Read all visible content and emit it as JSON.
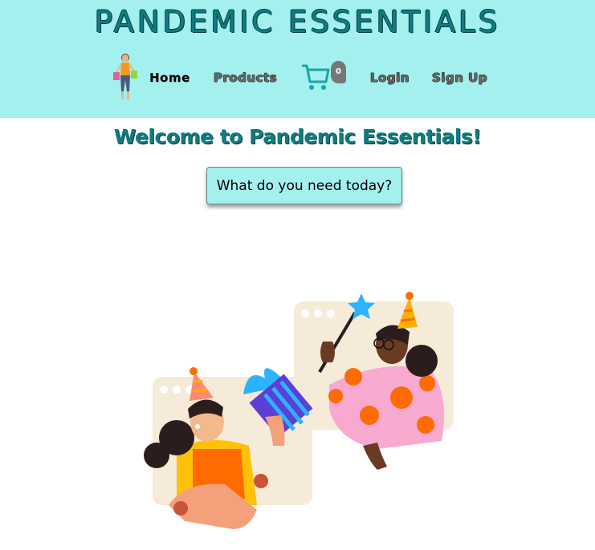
{
  "header": {
    "title": "PANDEMIC ESSENTIALS",
    "logo_icon": "shopper-woman-icon",
    "nav": {
      "home": "Home",
      "products": "Products",
      "login": "Login",
      "signup": "Sign Up"
    },
    "cart": {
      "icon": "shopping-cart-icon",
      "count": "0"
    }
  },
  "main": {
    "welcome": "Welcome to Pandemic Essentials!",
    "cta_label": "What do you need today?",
    "illustration_icon": "video-call-party-illustration"
  },
  "colors": {
    "header_bg": "#a3f0ee",
    "brand_teal": "#0f7c80",
    "cart_teal": "#1aa6a8",
    "badge_gray": "#777777"
  }
}
